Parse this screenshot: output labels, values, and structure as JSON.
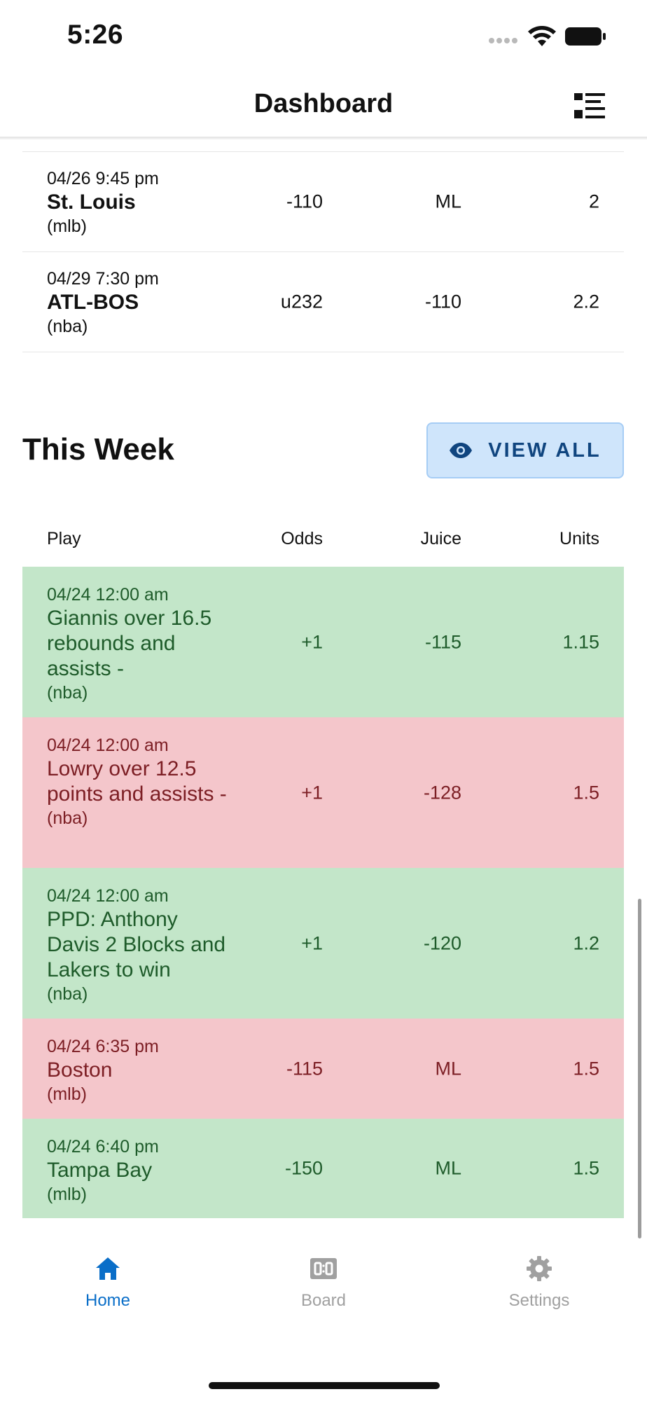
{
  "status_bar": {
    "time": "5:26"
  },
  "header": {
    "title": "Dashboard"
  },
  "upcoming_rows": [
    {
      "datetime": "04/26 9:45 pm",
      "team": "St. Louis",
      "league": "(mlb)",
      "odds": "-110",
      "juice": "ML",
      "units": "2"
    },
    {
      "datetime": "04/29 7:30 pm",
      "team": "ATL-BOS",
      "league": "(nba)",
      "odds": "u232",
      "juice": "-110",
      "units": "2.2"
    }
  ],
  "this_week": {
    "title": "This Week",
    "view_all_label": "VIEW ALL",
    "columns": {
      "play": "Play",
      "odds": "Odds",
      "juice": "Juice",
      "units": "Units"
    },
    "rows": [
      {
        "result": "win",
        "datetime": "04/24 12:00 am",
        "play": "Giannis over 16.5 rebounds and assists -",
        "league": "(nba)",
        "odds": "+1",
        "juice": "-115",
        "units": "1.15"
      },
      {
        "result": "loss",
        "datetime": "04/24 12:00 am",
        "play": "Lowry over 12.5 points and assists -",
        "league": "(nba)",
        "odds": "+1",
        "juice": "-128",
        "units": "1.5"
      },
      {
        "result": "win",
        "datetime": "04/24 12:00 am",
        "play": "PPD: Anthony Davis 2 Blocks and Lakers to win",
        "league": "(nba)",
        "odds": "+1",
        "juice": "-120",
        "units": "1.2"
      },
      {
        "result": "loss",
        "datetime": "04/24 6:35 pm",
        "play": "Boston",
        "league": "(mlb)",
        "odds": "-115",
        "juice": "ML",
        "units": "1.5"
      },
      {
        "result": "win",
        "datetime": "04/24 6:40 pm",
        "play": "Tampa Bay",
        "league": "(mlb)",
        "odds": "-150",
        "juice": "ML",
        "units": "1.5"
      }
    ]
  },
  "tab_bar": {
    "tabs": [
      {
        "label": "Home",
        "icon": "home-icon",
        "active": true
      },
      {
        "label": "Board",
        "icon": "scoreboard-icon",
        "active": false
      },
      {
        "label": "Settings",
        "icon": "gear-icon",
        "active": false
      }
    ]
  },
  "colors": {
    "accent": "#0a6ec8",
    "win_bg": "#c3e6c9",
    "loss_bg": "#f4c6cb",
    "button_bg": "#cfe5fb"
  }
}
